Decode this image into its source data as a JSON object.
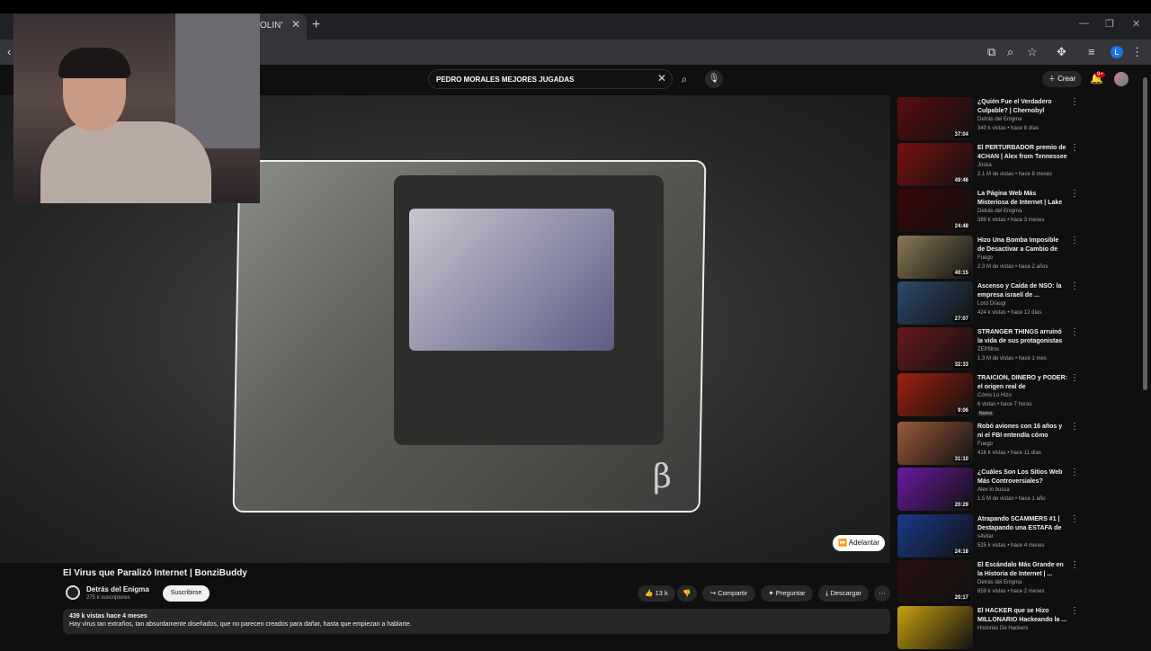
{
  "browser": {
    "tab_title": "OLIN'",
    "new_tab": "+",
    "close": "✕"
  },
  "profile": {
    "initial": "L"
  },
  "search": {
    "value": "PEDRO MORALES MEJORES JUGADAS"
  },
  "header": {
    "create_label": "Crear",
    "notification_badge": "9+"
  },
  "video": {
    "skip_label": "Adelantar",
    "title": "El Virus que Paralizó Internet | BonziBuddy",
    "channel": "Detrás del Enigma",
    "subscribers": "275 k suscriptores",
    "subscribe_label": "Suscribirse",
    "likes": "13 k",
    "share_label": "Compartir",
    "ask_label": "Preguntar",
    "download_label": "Descargar",
    "views_date": "439 k vistas  hace 4 meses",
    "description": "Hay virus tan extraños, tan absurdamente diseñados, que no parecen creados para dañar, hasta que empiezan a hablarte."
  },
  "recommendations": [
    {
      "title": "¿Quién Fue el Verdadero Culpable? | Chernobyl",
      "channel": "Detrás del Enigma",
      "meta": "340 k vistas • hace 8 días",
      "duration": "37:04",
      "thumb": "#5a0d0d"
    },
    {
      "title": "El PERTURBADOR premio de 4CHAN | Alex from Tennessee",
      "channel": "Joska",
      "meta": "2.1 M de vistas • hace 8 meses",
      "duration": "49:46",
      "thumb": "#7a1010"
    },
    {
      "title": "La Página Web Más Misteriosa de Internet | Lake City Quiet ...",
      "channel": "Detrás del Enigma",
      "meta": "389 k vistas • hace 3 meses",
      "duration": "24:48",
      "thumb": "#3a0505"
    },
    {
      "title": "Hizo Una Bomba Imposible de Desactivar a Cambio de $$$",
      "channel": "Fuego",
      "meta": "2.3 M de vistas • hace 2 años",
      "duration": "40:15",
      "thumb": "#8a7a55"
    },
    {
      "title": "Ascenso y Caída de NSO: la empresa israelí de ...",
      "channel": "Lord Draugr",
      "meta": "424 k vistas • hace 12 días",
      "duration": "27:07",
      "thumb": "#2b4a6a"
    },
    {
      "title": "STRANGER THINGS arruinó la vida de sus protagonistas",
      "channel": "ZEPfilms",
      "meta": "1.3 M de vistas • hace 1 mes",
      "duration": "32:33",
      "thumb": "#6a1a1a"
    },
    {
      "title": "TRAICIÓN, DINERO y PODER: el origen real de MCDONALD'S",
      "channel": "Cómo Lo Hizo",
      "meta": "6 vistas • hace 7 horas",
      "duration": "9:06",
      "thumb": "#a02010",
      "badge": "Nuevo"
    },
    {
      "title": "Robó aviones con 16 años y ni el FBI entendía cómo",
      "channel": "Fuego",
      "meta": "416 k vistas • hace 11 días",
      "duration": "31:10",
      "thumb": "#9a5a3a"
    },
    {
      "title": "¿Cuáles Son Los Sitios Web Más Controversiales?",
      "channel": "Alex lo busca",
      "meta": "1.5 M de vistas • hace 1 año",
      "duration": "20:29",
      "thumb": "#6a1aa0"
    },
    {
      "title": "Atrapando SCAMMERS #1 | Destapando una ESTAFA de ...",
      "channel": "s4vitar",
      "meta": "525 k vistas • hace 4 meses",
      "duration": "24:18",
      "thumb": "#1a3a8a"
    },
    {
      "title": "El Escándalo Más Grande en la Historia de Internet | ...",
      "channel": "Detrás del Enigma",
      "meta": "859 k vistas • hace 2 meses",
      "duration": "20:17",
      "thumb": "#2a1010"
    },
    {
      "title": "El HACKER que se Hizo MILLONARIO Hackeando la ...",
      "channel": "Historias De Hackers",
      "meta": "",
      "duration": "",
      "thumb": "#c8a010"
    }
  ]
}
